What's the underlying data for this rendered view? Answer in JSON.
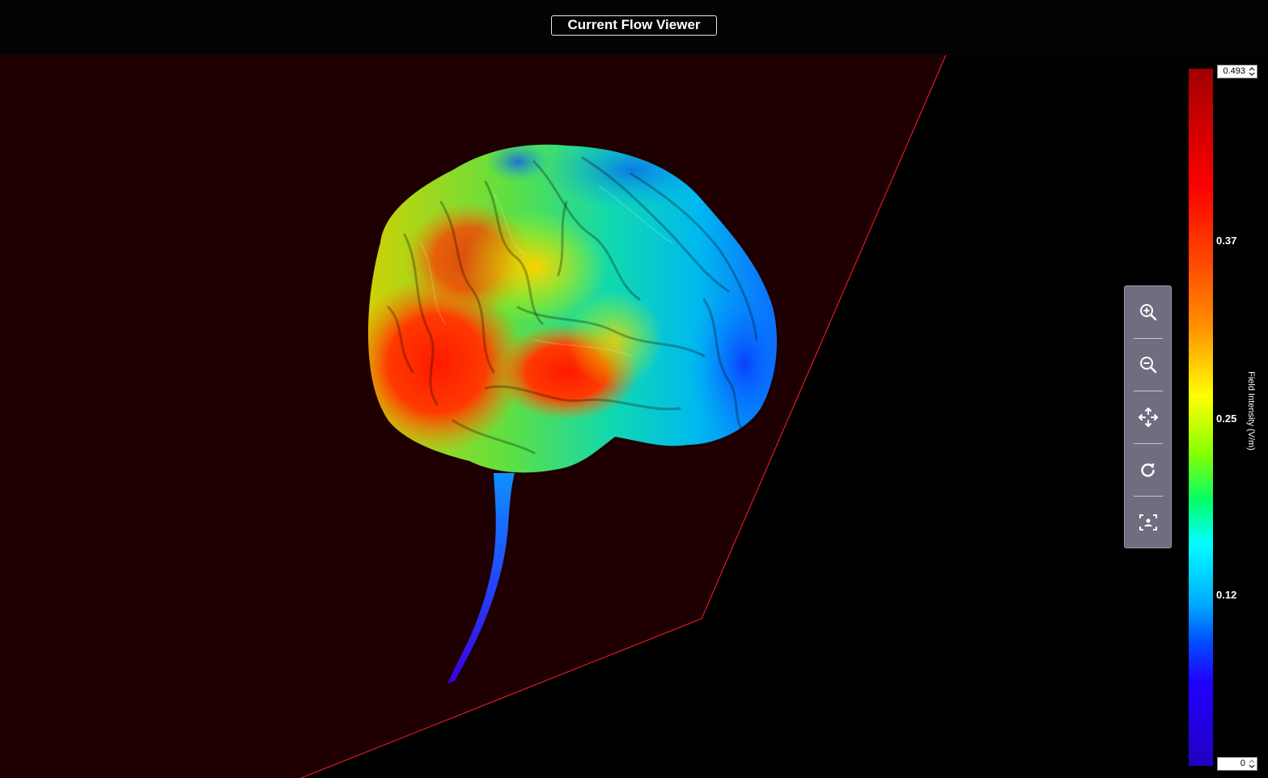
{
  "app": {
    "title": "Current Flow Viewer"
  },
  "toolbar": {
    "buttons": [
      {
        "name": "zoom-in",
        "icon": "zoom-in-icon"
      },
      {
        "name": "zoom-out",
        "icon": "zoom-out-icon"
      },
      {
        "name": "pan",
        "icon": "move-arrows-icon"
      },
      {
        "name": "reset-rotation",
        "icon": "rotate-icon"
      },
      {
        "name": "snapshot",
        "icon": "focus-frame-icon"
      }
    ]
  },
  "colorbar": {
    "label": "Field Intensity (V/m)",
    "max_value": "0.493",
    "min_value": "0",
    "ticks": [
      "0.37",
      "0.25",
      "0.12"
    ],
    "colors": [
      "#a00000",
      "#ff0000",
      "#ff9000",
      "#ffff00",
      "#00ff6a",
      "#00ffff",
      "#0050ff",
      "#2200c0"
    ]
  },
  "scene": {
    "background": "#000000",
    "plane_fill": "#1e0003",
    "plane_edge": "#ff2020"
  }
}
